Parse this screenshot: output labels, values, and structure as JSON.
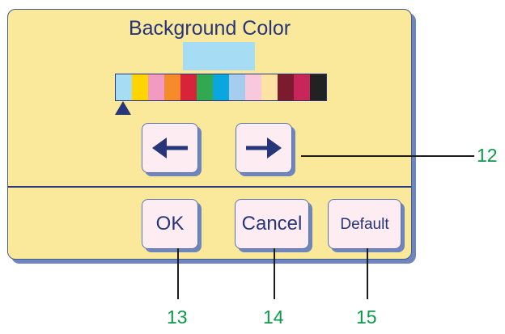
{
  "dialog": {
    "title": "Background Color",
    "preview_color": "#a7dcf5",
    "palette": [
      "#a7dcf5",
      "#ffd400",
      "#f29ac1",
      "#f58b2b",
      "#d7243a",
      "#33a853",
      "#0aa7df",
      "#a6cdee",
      "#f8c9dc",
      "#fde2a3",
      "#7c1a2f",
      "#c8265b",
      "#222222"
    ],
    "selected_index": 0,
    "buttons": {
      "prev_icon": "arrow-left-icon",
      "next_icon": "arrow-right-icon",
      "ok_label": "OK",
      "cancel_label": "Cancel",
      "default_label": "Default"
    }
  },
  "callouts": {
    "next": "12",
    "ok": "13",
    "cancel": "14",
    "default": "15"
  },
  "colors": {
    "panel": "#fae99a",
    "panel_border": "#3d5b98",
    "button": "#fdedf2",
    "text": "#27357a",
    "callout": "#0c9a4a"
  }
}
